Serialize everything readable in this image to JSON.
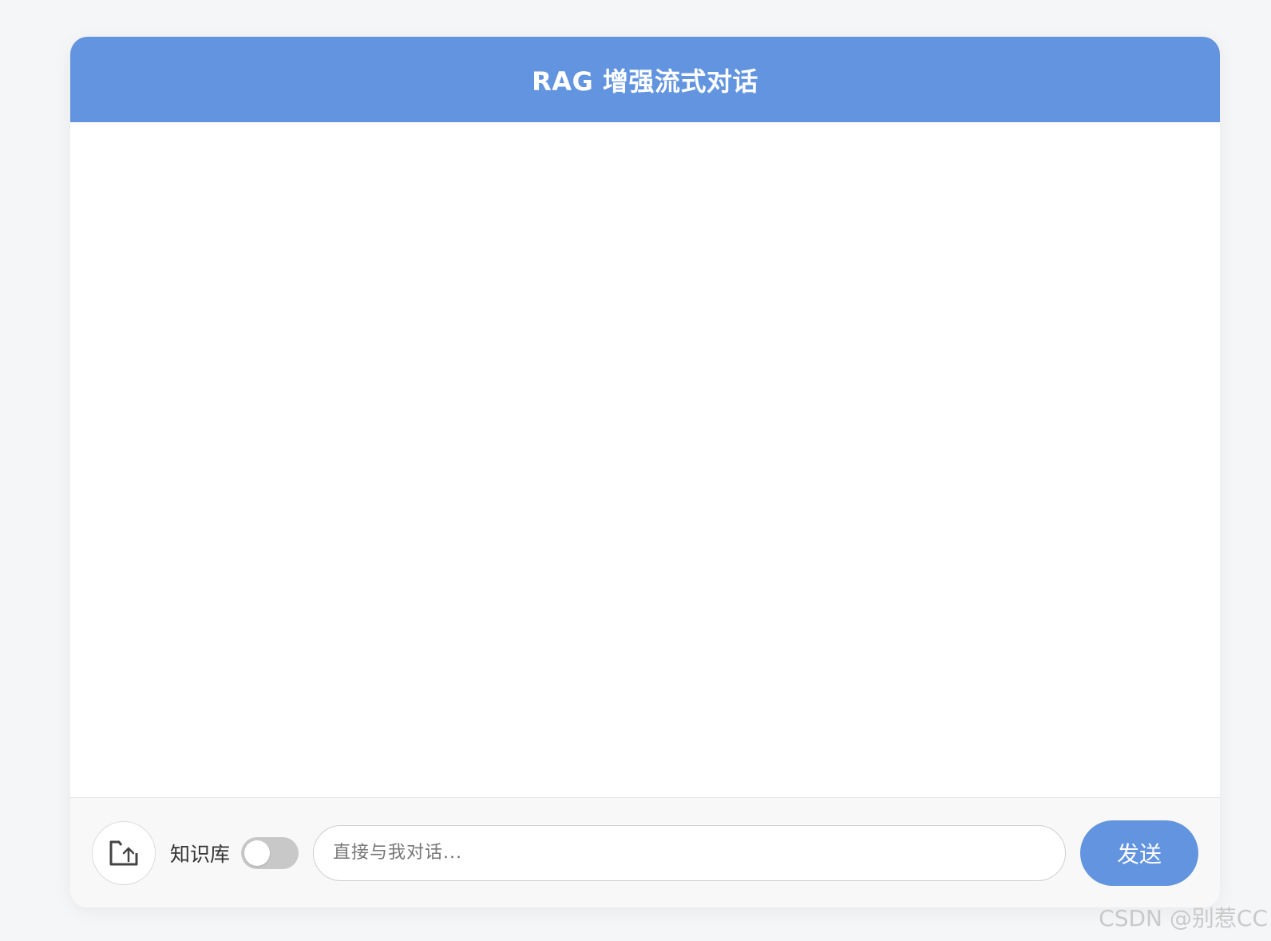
{
  "header": {
    "title": "RAG 增强流式对话"
  },
  "footer": {
    "upload_icon": "upload-file-icon",
    "knowledge_base_label": "知识库",
    "knowledge_base_enabled": false,
    "input_placeholder": "直接与我对话...",
    "input_value": "",
    "send_label": "发送"
  },
  "watermark": {
    "text": "CSDN @别惹CC"
  },
  "colors": {
    "accent": "#6294df",
    "page_background": "#f5f6f8",
    "footer_background": "#f8f8f8",
    "toggle_off": "#c8c8c8"
  }
}
